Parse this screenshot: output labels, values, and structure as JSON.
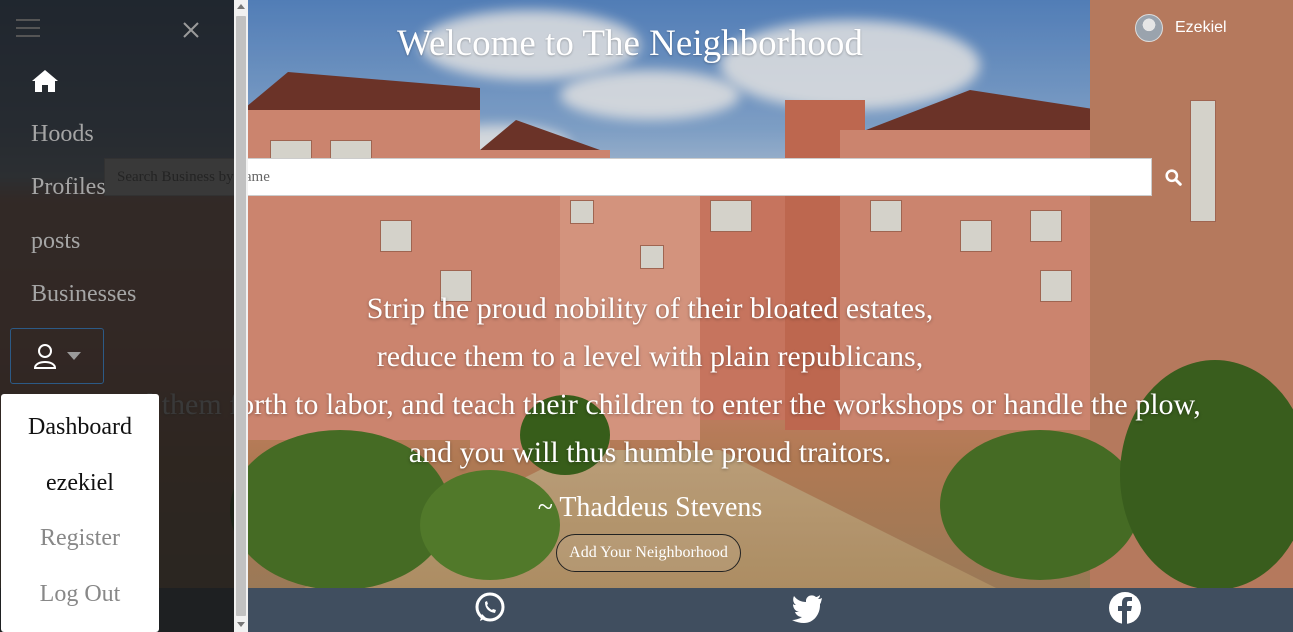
{
  "header": {
    "title": "Welcome to The Neighborhood",
    "user_name": "Ezekiel"
  },
  "search": {
    "placeholder": "Search Business by name"
  },
  "quote": {
    "lines": [
      "Strip the proud nobility of their bloated estates,",
      "reduce them to a level with plain republicans,",
      "send them forth to labor, and teach their children to enter the workshops or handle the plow,",
      "and you will thus humble proud traitors."
    ],
    "author": "~ Thaddeus Stevens"
  },
  "cta": {
    "add_label": "Add Your Neighborhood"
  },
  "sidebar": {
    "items": [
      {
        "label": "Hoods"
      },
      {
        "label": "Profiles"
      },
      {
        "label": "posts"
      },
      {
        "label": "Businesses"
      }
    ],
    "dropdown": [
      {
        "label": "Dashboard"
      },
      {
        "label": "ezekiel"
      },
      {
        "label": "Register"
      },
      {
        "label": "Log Out"
      }
    ]
  },
  "footer": {
    "icons": [
      "whatsapp-icon",
      "twitter-icon",
      "facebook-icon"
    ]
  },
  "colors": {
    "footer_bg": "#404e5f",
    "sidebar_bg": "#191919",
    "nav_text": "#a5a5a5",
    "toggle_border": "#2c5a86"
  }
}
